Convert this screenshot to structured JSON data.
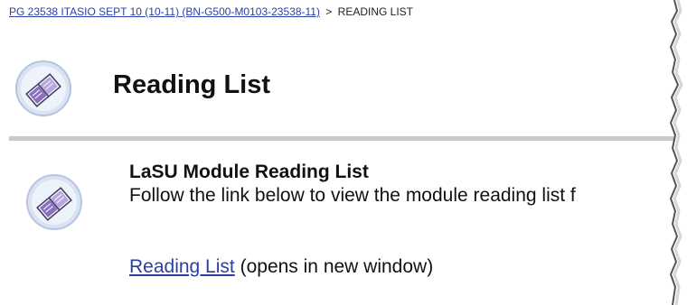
{
  "breadcrumb": {
    "course_link": "PG 23538 ITASIO SEPT 10 (10-11) (BN-G500-M0103-23538-11)",
    "separator": ">",
    "current": "READING LIST"
  },
  "header": {
    "title": "Reading List",
    "icon": "reading-list-book-icon"
  },
  "item": {
    "title": "LaSU Module Reading List",
    "description": "Follow the link below to view the module reading list f",
    "link_label": "Reading List",
    "link_note": "(opens in new window)",
    "icon": "reading-list-book-icon"
  },
  "colors": {
    "link": "#2a3fa8",
    "divider": "#c9c9c9",
    "icon_circle": "#dbe3f3"
  }
}
